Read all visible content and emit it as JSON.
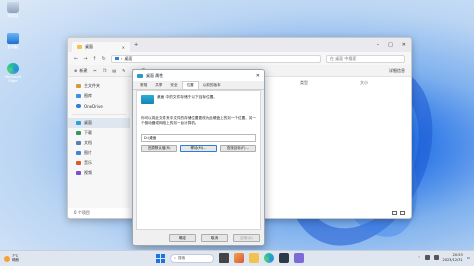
{
  "desktop": {
    "icons": [
      {
        "label": "回收站",
        "icon": "recycle-bin-icon"
      },
      {
        "label": "此电脑",
        "icon": "this-pc-icon"
      },
      {
        "label": "Microsoft Edge",
        "icon": "edge-icon"
      }
    ]
  },
  "explorer": {
    "tab_label": "桌面",
    "address": "桌面",
    "search_placeholder": "在 桌面 中搜索",
    "toolbar": {
      "new_label": "新建",
      "detail_label": "详细信息"
    },
    "sidebar": {
      "group1": [
        {
          "label": "主文件夹",
          "icon": "home-icon"
        },
        {
          "label": "图库",
          "icon": "gallery-icon"
        },
        {
          "label": "OneDrive",
          "icon": "onedrive-icon"
        }
      ],
      "group2": [
        {
          "label": "桌面",
          "icon": "desktop-folder-icon",
          "selected": true
        },
        {
          "label": "下载",
          "icon": "download-icon"
        },
        {
          "label": "文档",
          "icon": "documents-icon"
        },
        {
          "label": "图片",
          "icon": "pictures-icon"
        },
        {
          "label": "音乐",
          "icon": "music-icon"
        },
        {
          "label": "视频",
          "icon": "videos-icon"
        }
      ]
    },
    "columns": [
      "名称",
      "修改日期",
      "类型",
      "大小"
    ],
    "status": "0 个项目"
  },
  "dialog": {
    "title": "桌面 属性",
    "tabs": [
      "常规",
      "共享",
      "安全",
      "位置",
      "以前的版本"
    ],
    "active_tab": "位置",
    "header_text": "桌面 中的文件存储于以下目标位置。",
    "paragraph": "你可以将此文件夹中文件的存储位置更改为此硬盘上的另一个位置、另一个驱动器或网络上的另一台计算机。",
    "path_value": "D:\\桌面",
    "buttons": {
      "restore": "还原默认值(R)",
      "move": "移动(M)...",
      "find": "查找目标(F)..."
    },
    "footer": {
      "ok": "确定",
      "cancel": "取消",
      "apply": "应用(A)"
    }
  },
  "taskbar": {
    "weather_temp": "7°C",
    "weather_desc": "晴朗",
    "search_label": "搜索",
    "time": "20:53",
    "date": "2023/12/31"
  }
}
